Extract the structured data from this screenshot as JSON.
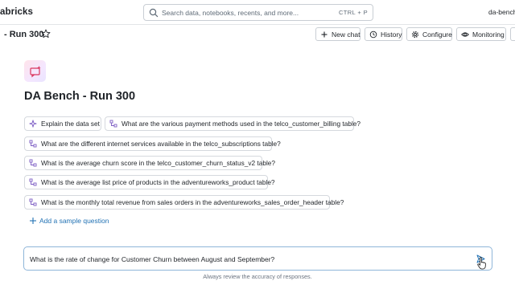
{
  "topbar": {
    "brand": "abricks",
    "search_placeholder": "Search data, notebooks, recents, and more...",
    "search_shortcut": "CTRL + P",
    "workspace": "da-bench"
  },
  "header": {
    "page_title": "- Run 300",
    "buttons": {
      "new_chat": "New chat",
      "history": "History",
      "configure": "Configure",
      "monitoring": "Monitoring"
    }
  },
  "space": {
    "title": "DA Bench - Run 300"
  },
  "suggestions": [
    "Explain the data set",
    "What are the various payment methods used in the telco_customer_billing table?",
    "What are the different internet services available in the telco_subscriptions table?",
    "What is the average churn score in the telco_customer_churn_status_v2 table?",
    "What is the average list price of products in the adventureworks_product table?",
    "What is the monthly total revenue from sales orders in the adventureworks_sales_order_header table?"
  ],
  "add_sample_label": "Add a sample question",
  "chat": {
    "input_value": "What is the rate of change for Customer Churn between August and September?"
  },
  "disclaimer": "Always review the accuracy of responses.",
  "colors": {
    "accent": "#2272b4",
    "chip_icon": "#7c5cc4",
    "border": "#d5d9de"
  },
  "icons": {
    "search": "search-icon",
    "star": "star-icon",
    "new_chat": "plus-icon",
    "history": "history-icon",
    "configure": "gear-icon",
    "monitoring": "eye-icon",
    "sparkle": "sparkle-icon",
    "query": "query-icon",
    "send": "send-icon"
  }
}
